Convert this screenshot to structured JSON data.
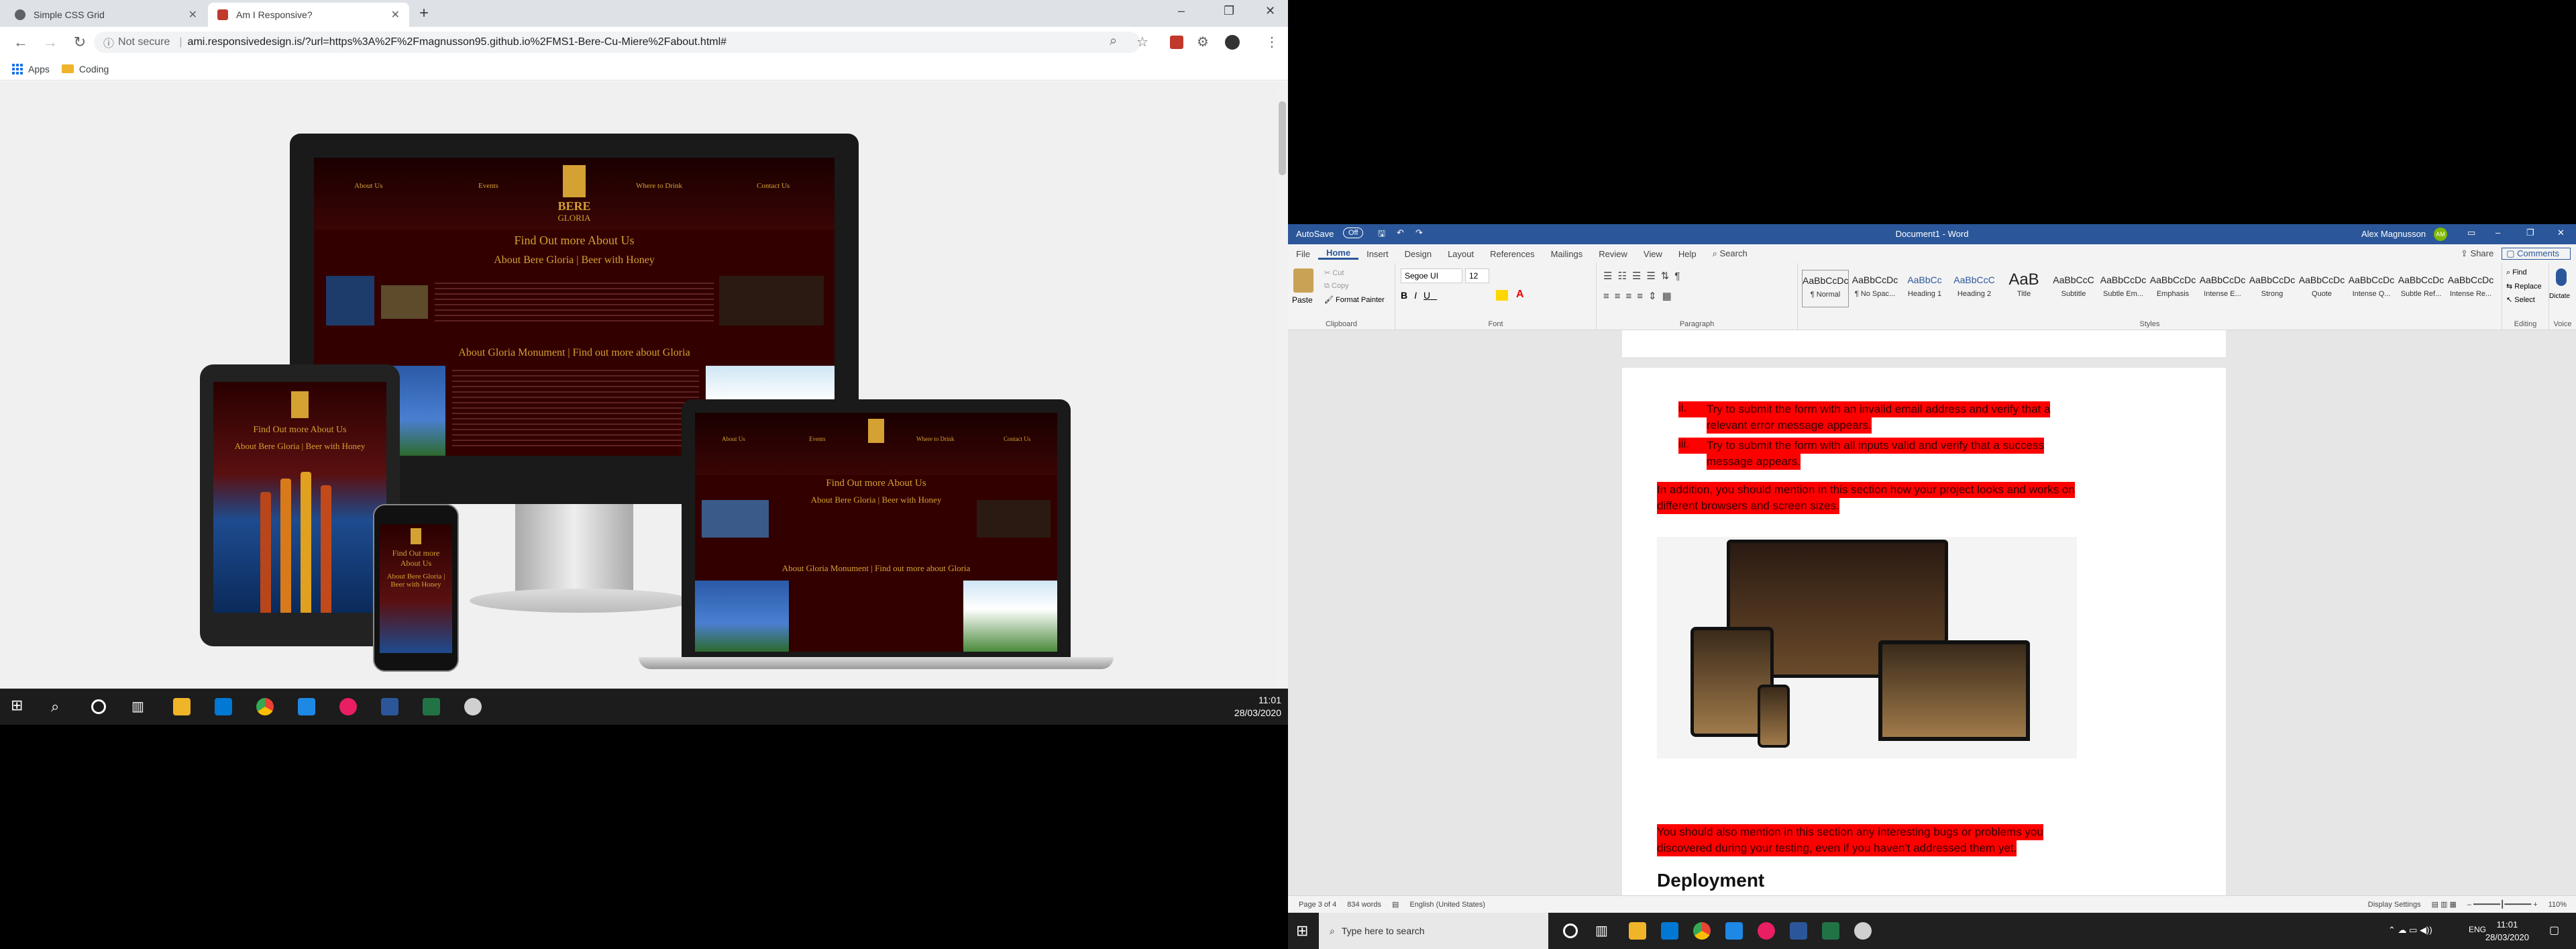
{
  "chrome": {
    "tabs": [
      {
        "title": "Simple CSS Grid",
        "active": false,
        "color": "#5f6368"
      },
      {
        "title": "Am I Responsive?",
        "active": true,
        "color": "#c0392b"
      }
    ],
    "omnibox": {
      "security": "Not secure",
      "url": "ami.responsivedesign.is/?url=https%3A%2F%2Fmagnusson95.github.io%2FMS1-Bere-Cu-Miere%2Fabout.html#"
    },
    "bookmarks": [
      {
        "label": "Apps",
        "icon": "apps-grid-icon"
      },
      {
        "label": "Coding",
        "icon": "folder-icon"
      }
    ]
  },
  "site": {
    "nav": [
      "About Us",
      "Events",
      "Where to Drink",
      "Contact Us"
    ],
    "brand": [
      "BERE",
      "GLORIA"
    ],
    "heading": "Find Out more About Us",
    "section1": "About Bere Gloria | Beer with Honey",
    "section2": "About Gloria Monument | Find out more about Gloria",
    "tablet_heading": "Find Out more About Us",
    "tablet_section": "About Bere Gloria | Beer with Honey",
    "phone_heading": "Find Out more About Us",
    "phone_section": "About Bere Gloria | Beer with Honey"
  },
  "taskbar_left": {
    "time": "11:01",
    "date": "28/03/2020",
    "apps": [
      {
        "icon": "file-explorer-icon",
        "color": "#f0b429"
      },
      {
        "icon": "mail-icon",
        "color": "#0078d4"
      },
      {
        "icon": "chrome-icon",
        "color": "#4caf50"
      },
      {
        "icon": "vscode-icon",
        "color": "#1e88e5"
      },
      {
        "icon": "slack-icon",
        "color": "#e91e63"
      },
      {
        "icon": "word-icon",
        "color": "#2b579a"
      },
      {
        "icon": "excel-icon",
        "color": "#217346"
      },
      {
        "icon": "paint-icon",
        "color": "#d0d0d0"
      }
    ]
  },
  "word": {
    "title": "Document1 - Word",
    "autosave": "AutoSave",
    "autosave_state": "Off",
    "user": "Alex Magnusson",
    "user_initials": "AM",
    "tabs": [
      "File",
      "Home",
      "Insert",
      "Design",
      "Layout",
      "References",
      "Mailings",
      "Review",
      "View",
      "Help"
    ],
    "search": "Search",
    "share": "Share",
    "comments": "Comments",
    "clipboard": {
      "paste": "Paste",
      "cut": "Cut",
      "copy": "Copy",
      "format_painter": "Format Painter",
      "label": "Clipboard"
    },
    "font": {
      "name": "Segoe UI",
      "size": "12",
      "label": "Font"
    },
    "paragraph_label": "Paragraph",
    "styles": [
      {
        "sample": "AaBbCcDc",
        "name": "¶ Normal"
      },
      {
        "sample": "AaBbCcDc",
        "name": "¶ No Spac..."
      },
      {
        "sample": "AaBbCc",
        "name": "Heading 1"
      },
      {
        "sample": "AaBbCcC",
        "name": "Heading 2"
      },
      {
        "sample": "AaB",
        "name": "Title"
      },
      {
        "sample": "AaBbCcC",
        "name": "Subtitle"
      },
      {
        "sample": "AaBbCcDc",
        "name": "Subtle Em..."
      },
      {
        "sample": "AaBbCcDc",
        "name": "Emphasis"
      },
      {
        "sample": "AaBbCcDc",
        "name": "Intense E..."
      },
      {
        "sample": "AaBbCcDc",
        "name": "Strong"
      },
      {
        "sample": "AaBbCcDc",
        "name": "Quote"
      },
      {
        "sample": "AaBbCcDc",
        "name": "Intense Q..."
      },
      {
        "sample": "AaBbCcDc",
        "name": "Subtle Ref..."
      },
      {
        "sample": "AaBbCcDc",
        "name": "Intense Re..."
      }
    ],
    "styles_label": "Styles",
    "editing": {
      "find": "Find",
      "replace": "Replace",
      "select": "Select",
      "label": "Editing"
    },
    "voice": {
      "dictate": "Dictate",
      "label": "Voice"
    },
    "doc": {
      "bullets": [
        {
          "num": "ii.",
          "text_l1": "Try to submit the form with an invalid email address and verify that a",
          "text_l2": "relevant error message appears."
        },
        {
          "num": "iii.",
          "text_l1": "Try to submit the form with all inputs valid and verify that a success",
          "text_l2": "message appears."
        }
      ],
      "para1_l1": "In addition, you should mention in this section how your project looks and works on",
      "para1_l2": "different browsers and screen sizes.",
      "para2_l1": "You should also mention in this section any interesting bugs or problems you",
      "para2_l2": "discovered during your testing, even if you haven't addressed them yet.",
      "heading": "Deployment"
    },
    "status": {
      "page": "Page 3 of 4",
      "words": "834 words",
      "lang": "English (United States)",
      "display": "Display Settings",
      "zoom": "110%"
    }
  },
  "taskbar_right": {
    "search_placeholder": "Type here to search",
    "time": "11:01",
    "date": "28/03/2020",
    "lang": "ENG"
  }
}
